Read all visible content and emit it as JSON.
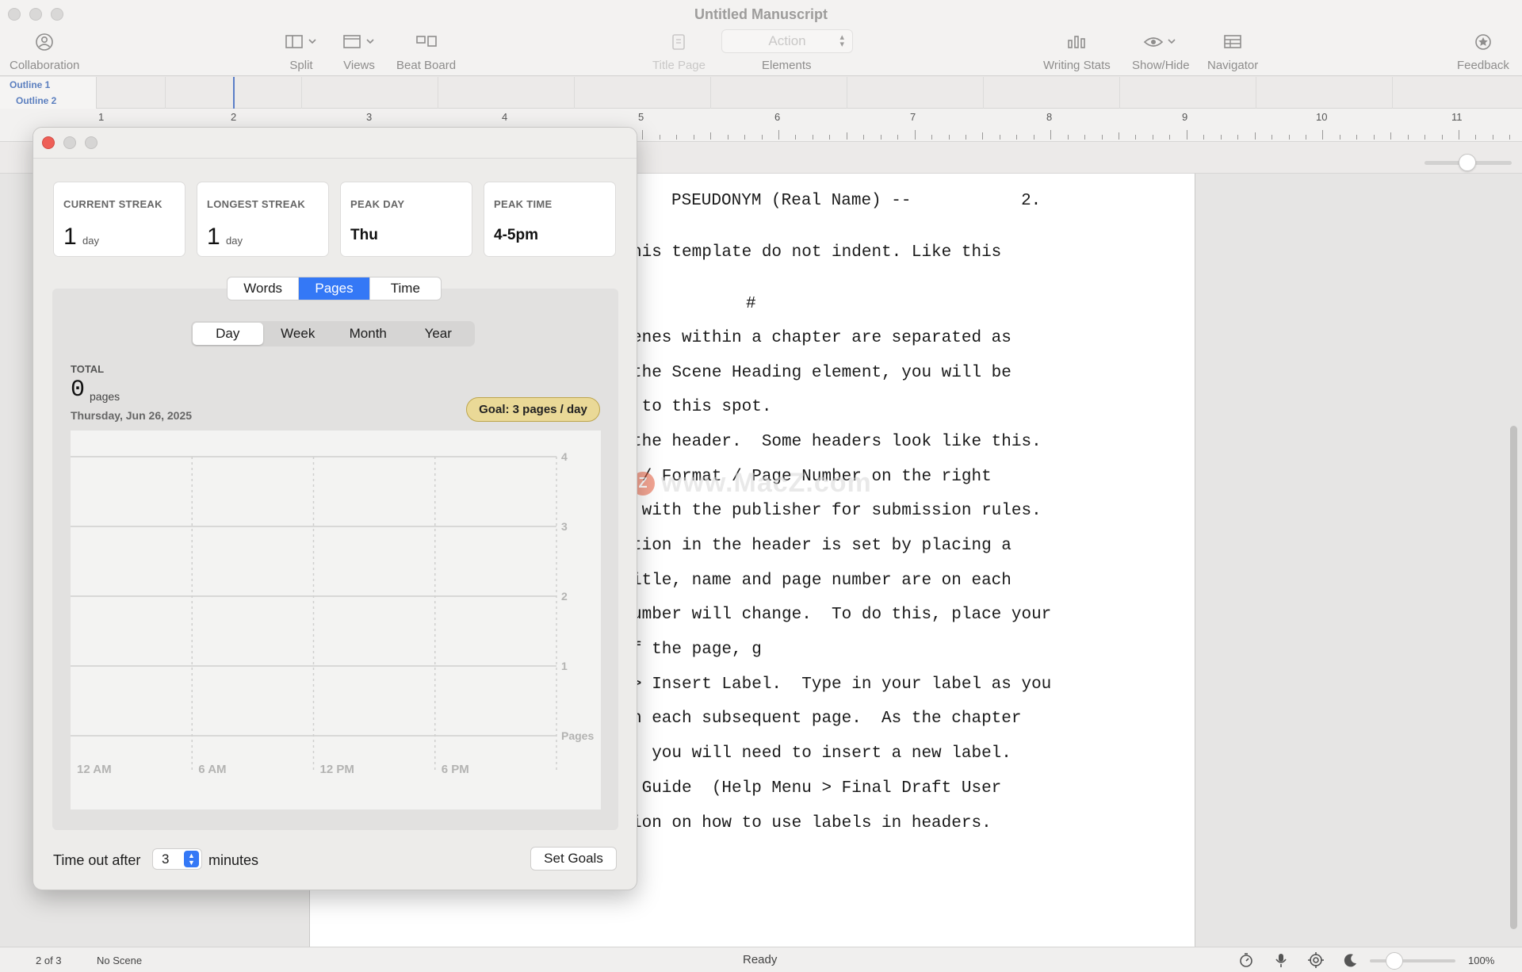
{
  "window": {
    "title": "Untitled Manuscript"
  },
  "toolbar": {
    "collaboration": "Collaboration",
    "split": "Split",
    "views": "Views",
    "beat_board": "Beat Board",
    "title_page": "Title Page",
    "elements": "Elements",
    "element_value": "Action",
    "writing_stats": "Writing Stats",
    "show_hide": "Show/Hide",
    "navigator": "Navigator",
    "feedback": "Feedback"
  },
  "outline": {
    "items": [
      "Outline 1",
      "Outline 2"
    ]
  },
  "ruler": {
    "numbers": [
      "1",
      "2",
      "3",
      "4",
      "5",
      "6",
      "7",
      "8",
      "9",
      "10",
      "11"
    ]
  },
  "document": {
    "lines": [
      "PSEUDONYM (Real Name) --           2.",
      "his template do not indent. Like this",
      "#",
      "enes within a chapter are separated as",
      "the Scene Heading element, you will be",
      " to this spot.",
      "the header.  Some headers look like this.",
      " / Format / Page Number on the right",
      " with the publisher for submission rules.",
      "tion in the header is set by placing a",
      "itle, name and page number are on each",
      "umber will change.  To do this, place your",
      "f the page, g",
      "> Insert Label.  Type in your label as you",
      "n each subsequent page.  As the chapter",
      ", you will need to insert a new label.",
      " Guide  (Help Menu > Final Draft User",
      "ion on how to use labels in headers."
    ]
  },
  "watermark": {
    "text": "www.MacZ.com",
    "logo": "Z"
  },
  "stats": {
    "cards": [
      {
        "caption": "CURRENT STREAK",
        "value": "1",
        "unit": "day"
      },
      {
        "caption": "LONGEST STREAK",
        "value": "1",
        "unit": "day"
      },
      {
        "caption": "PEAK DAY",
        "value": "Thu"
      },
      {
        "caption": "PEAK TIME",
        "value": "4-5pm"
      }
    ],
    "metric_tabs": [
      "Words",
      "Pages",
      "Time"
    ],
    "metric_selected": "Pages",
    "period_tabs": [
      "Day",
      "Week",
      "Month",
      "Year"
    ],
    "period_selected": "Day",
    "total_caption": "TOTAL",
    "total_value": "0",
    "total_unit": "pages",
    "total_date": "Thursday, Jun 26, 2025",
    "goal": "Goal: 3 pages / day",
    "timeout_label": "Time out after",
    "timeout_value": "3",
    "timeout_unit": "minutes",
    "set_goals": "Set Goals"
  },
  "chart_data": {
    "type": "bar",
    "x_ticks": [
      "12 AM",
      "6 AM",
      "12 PM",
      "6 PM"
    ],
    "y_ticks": [
      "4",
      "3",
      "2",
      "1"
    ],
    "ylabel": "Pages",
    "ylim": [
      0,
      4
    ],
    "series": [
      {
        "values": []
      }
    ],
    "grid": true
  },
  "statusbar": {
    "page": "2 of 3",
    "scene": "No Scene",
    "status": "Ready",
    "zoom": "100%"
  },
  "colors": {
    "accent": "#3478f6",
    "goal_fill": "#ead997",
    "close_red": "#ee5f57"
  }
}
